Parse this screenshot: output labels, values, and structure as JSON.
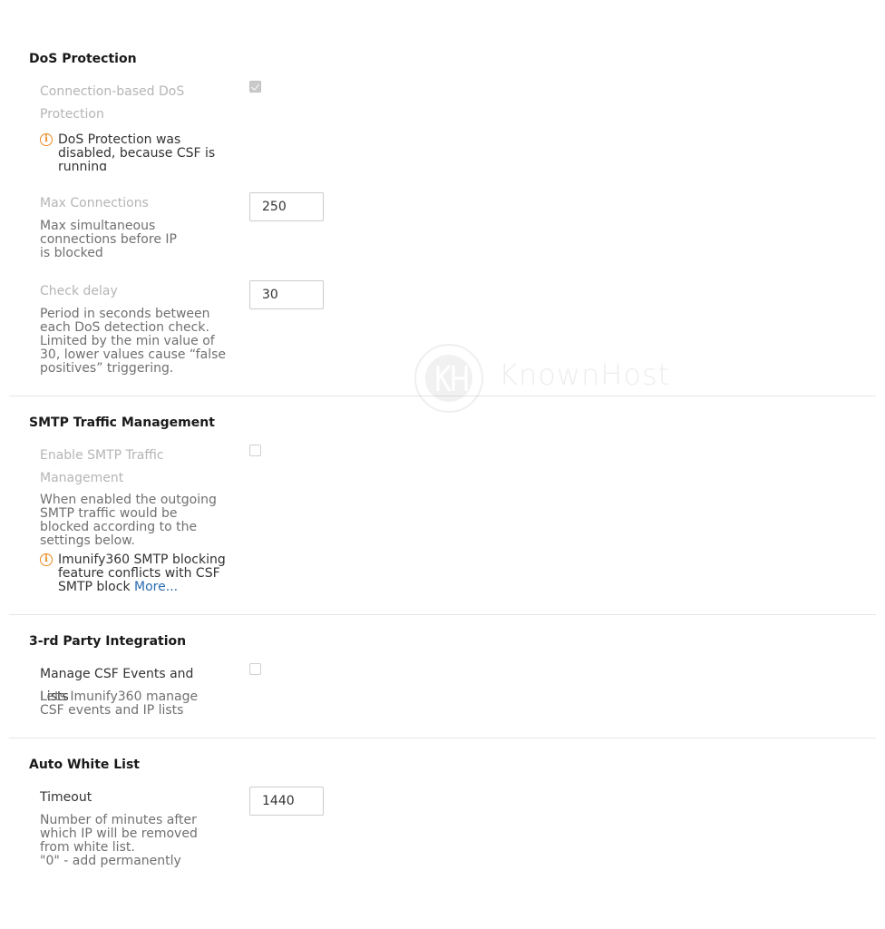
{
  "dos": {
    "title": "DoS Protection",
    "connection_label": "Connection-based DoS Protection",
    "connection_checked": true,
    "warning": "DoS Protection was disabled, because CSF is running",
    "max_connections": {
      "label": "Max Connections",
      "description": "Max simultaneous connections before IP is blocked",
      "value": "250"
    },
    "check_delay": {
      "label": "Check delay",
      "description": "Period in seconds between each DoS detection check. Limited by the min value of 30, lower values cause “false positives” triggering.",
      "value": "30"
    }
  },
  "smtp": {
    "title": "SMTP Traffic Management",
    "enable_label": "Enable SMTP Traffic Management",
    "enable_checked": false,
    "description": "When enabled the outgoing SMTP traffic would be blocked according to the settings below.",
    "warning": "Imunify360 SMTP blocking feature conflicts with CSF SMTP block",
    "more_link": "More..."
  },
  "third_party": {
    "title": "3-rd Party Integration",
    "csf_label": "Manage CSF Events and Lists",
    "csf_checked": false,
    "description": "Lets Imunify360 manage CSF events and IP lists"
  },
  "auto_white_list": {
    "title": "Auto White List",
    "timeout_label": "Timeout",
    "description_lines": [
      "Number of minutes after which IP will be removed from white list.",
      "\"0\" - add permanently"
    ],
    "timeout_value": "1440"
  },
  "watermark": {
    "text": "KnownHost",
    "logo_letters": "KH"
  },
  "colors": {
    "warning_icon": "#e8891c",
    "link": "#2a6db0",
    "disabled_label": "#b5b5b5",
    "description": "#707070"
  },
  "icons": {
    "warning": "info-circle-icon",
    "checkbox_checked": "checkmark-icon"
  }
}
